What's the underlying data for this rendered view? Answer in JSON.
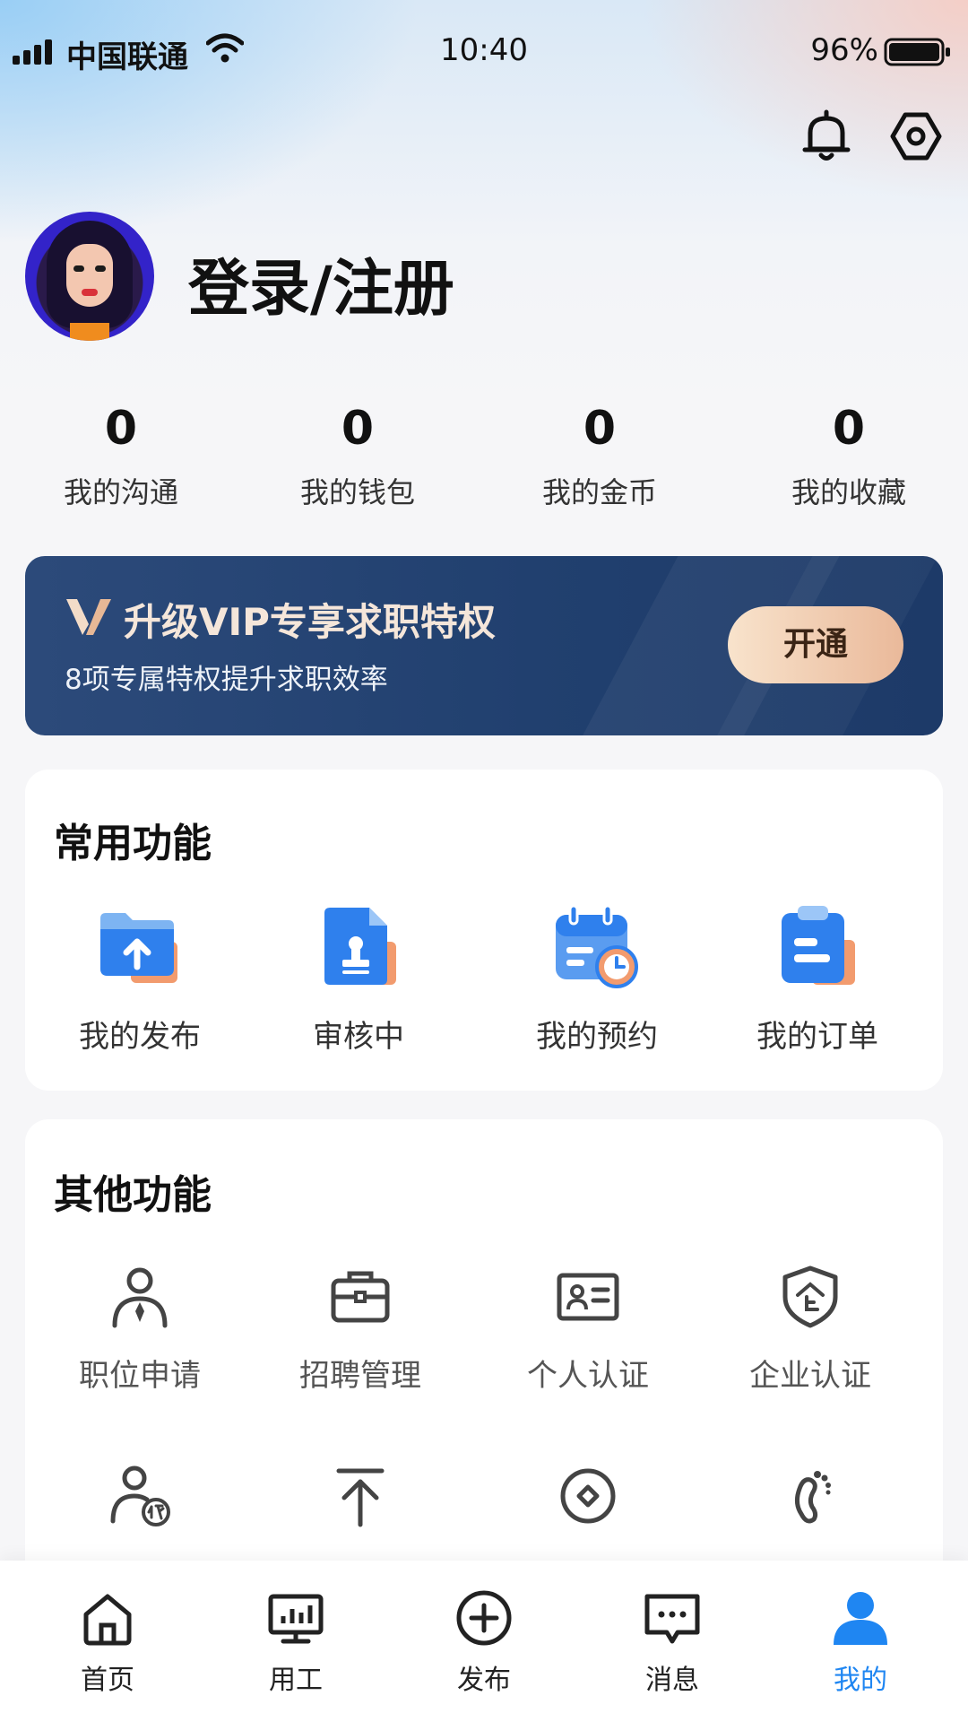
{
  "status_bar": {
    "carrier": "中国联通",
    "time": "10:40",
    "battery": "96%"
  },
  "header": {
    "icons": [
      "bell-icon",
      "settings-hexagon-icon"
    ]
  },
  "profile": {
    "login_label": "登录/注册"
  },
  "stats": [
    {
      "value": "0",
      "label": "我的沟通"
    },
    {
      "value": "0",
      "label": "我的钱包"
    },
    {
      "value": "0",
      "label": "我的金币"
    },
    {
      "value": "0",
      "label": "我的收藏"
    }
  ],
  "vip_banner": {
    "title": "升级VIP专享求职特权",
    "subtitle": "8项专属特权提升求职效率",
    "button": "开通"
  },
  "common_features": {
    "title": "常用功能",
    "items": [
      {
        "label": "我的发布",
        "icon": "folder-upload-icon"
      },
      {
        "label": "审核中",
        "icon": "document-stamp-icon"
      },
      {
        "label": "我的预约",
        "icon": "calendar-clock-icon"
      },
      {
        "label": "我的订单",
        "icon": "clipboard-icon"
      }
    ]
  },
  "other_features": {
    "title": "其他功能",
    "items": [
      {
        "label": "职位申请",
        "icon": "person-tie-icon"
      },
      {
        "label": "招聘管理",
        "icon": "briefcase-icon"
      },
      {
        "label": "个人认证",
        "icon": "id-card-icon"
      },
      {
        "label": "企业认证",
        "icon": "shield-enterprise-icon"
      },
      {
        "label": "",
        "icon": "person-proxy-icon"
      },
      {
        "label": "",
        "icon": "arrow-top-icon"
      },
      {
        "label": "",
        "icon": "circle-diamond-icon"
      },
      {
        "label": "",
        "icon": "footprint-icon"
      }
    ]
  },
  "bottom_nav": {
    "items": [
      {
        "label": "首页",
        "icon": "home-icon"
      },
      {
        "label": "用工",
        "icon": "monitor-chart-icon"
      },
      {
        "label": "发布",
        "icon": "plus-circle-icon"
      },
      {
        "label": "消息",
        "icon": "message-icon"
      },
      {
        "label": "我的",
        "icon": "user-icon"
      }
    ],
    "active": "我的",
    "active_color": "#1f86f2"
  },
  "colors": {
    "vip_background": "#21406f",
    "vip_button": "#eab99a",
    "feature_blue": "#2f80ed",
    "feature_orange": "#f29b6e"
  }
}
